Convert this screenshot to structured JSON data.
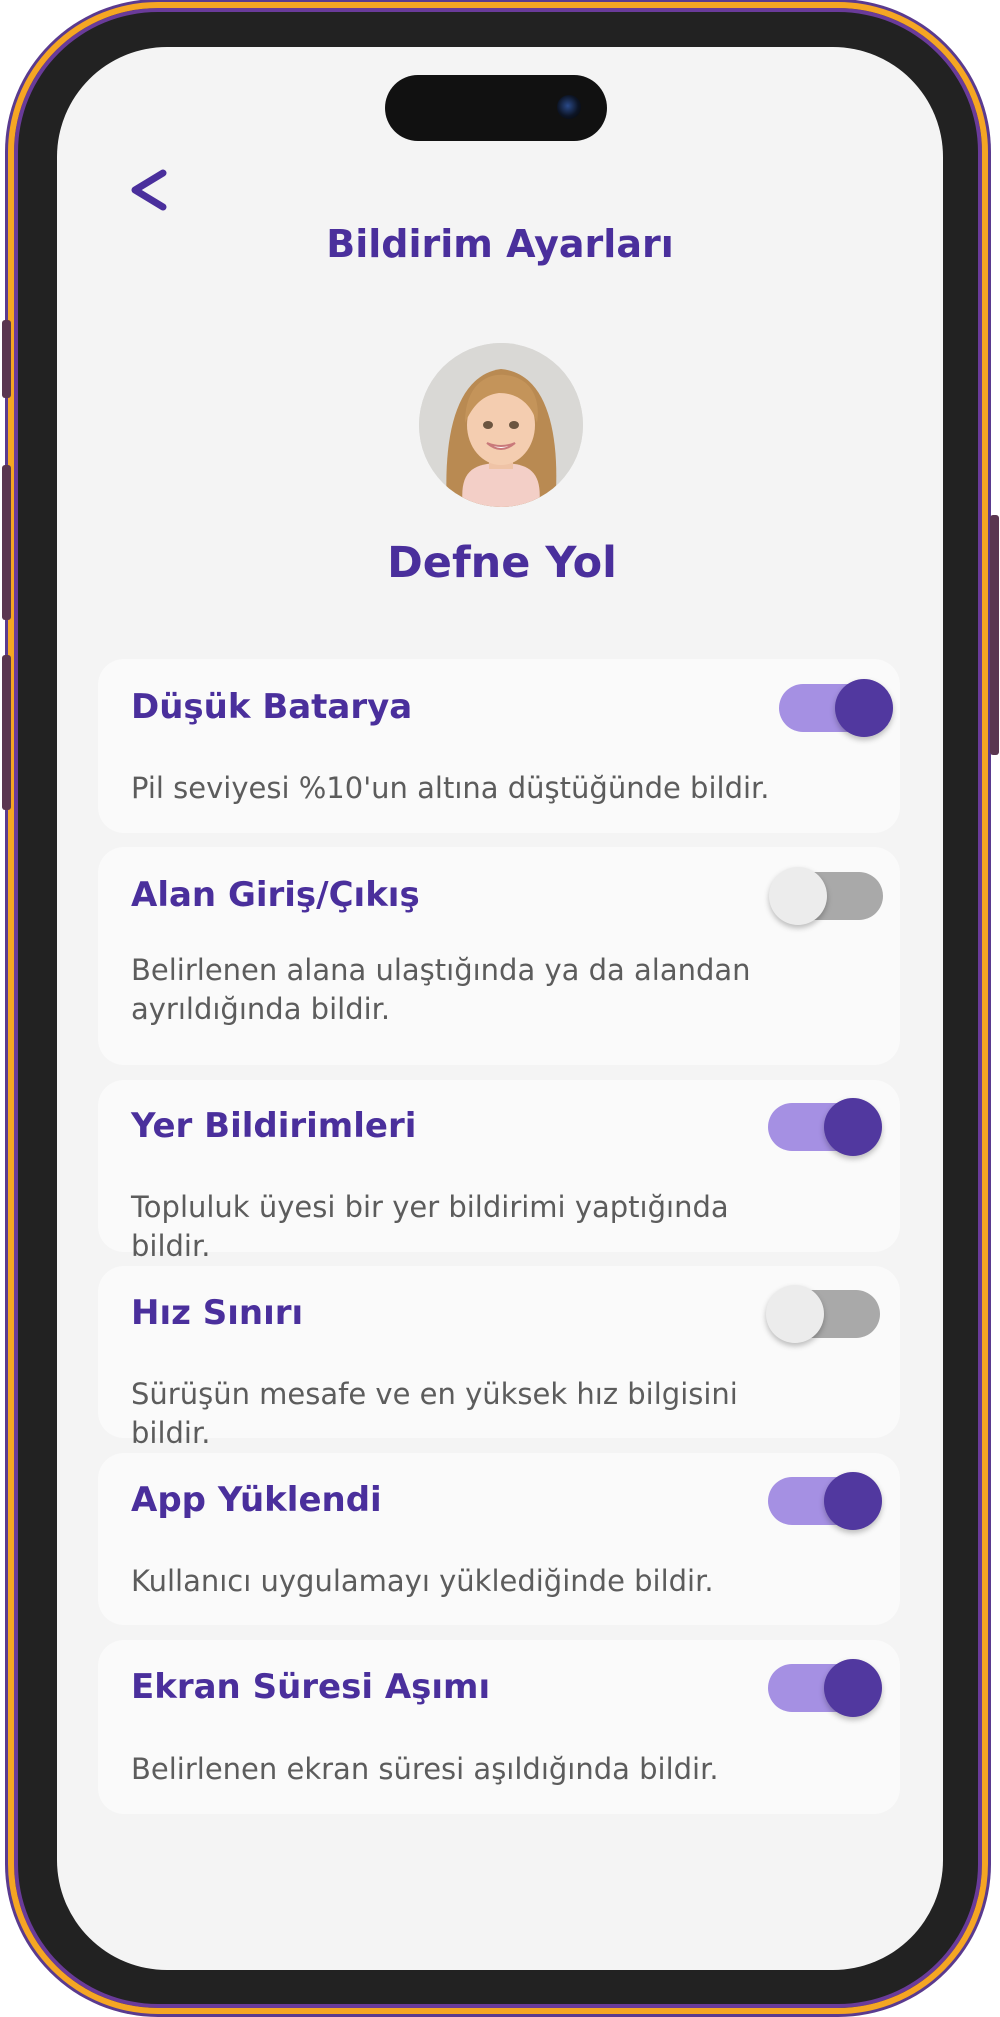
{
  "header": {
    "title": "Bildirim Ayarları"
  },
  "profile": {
    "name": "Defne Yol"
  },
  "colors": {
    "accent": "#4a2f9c",
    "toggle_on_track": "#a590e3",
    "toggle_on_knob": "#51389f",
    "toggle_off_track": "#a9a9a9",
    "frame_border": "#f5a623"
  },
  "settings": [
    {
      "title": "Düşük Batarya",
      "description": "Pil seviyesi %10'un altına düştüğünde bildir.",
      "enabled": true
    },
    {
      "title": "Alan Giriş/Çıkış",
      "description": "Belirlenen alana ulaştığında ya da alandan ayrıldığında bildir.",
      "enabled": false
    },
    {
      "title": "Yer Bildirimleri",
      "description": "Topluluk üyesi bir yer bildirimi yaptığında bildir.",
      "enabled": true
    },
    {
      "title": "Hız Sınırı",
      "description": "Sürüşün mesafe ve en yüksek hız bilgisini  bildir.",
      "enabled": false
    },
    {
      "title": "App Yüklendi",
      "description": "Kullanıcı uygulamayı yüklediğinde bildir.",
      "enabled": true
    },
    {
      "title": "Ekran Süresi Aşımı",
      "description": "Belirlenen ekran süresi aşıldığında bildir.",
      "enabled": true
    }
  ]
}
